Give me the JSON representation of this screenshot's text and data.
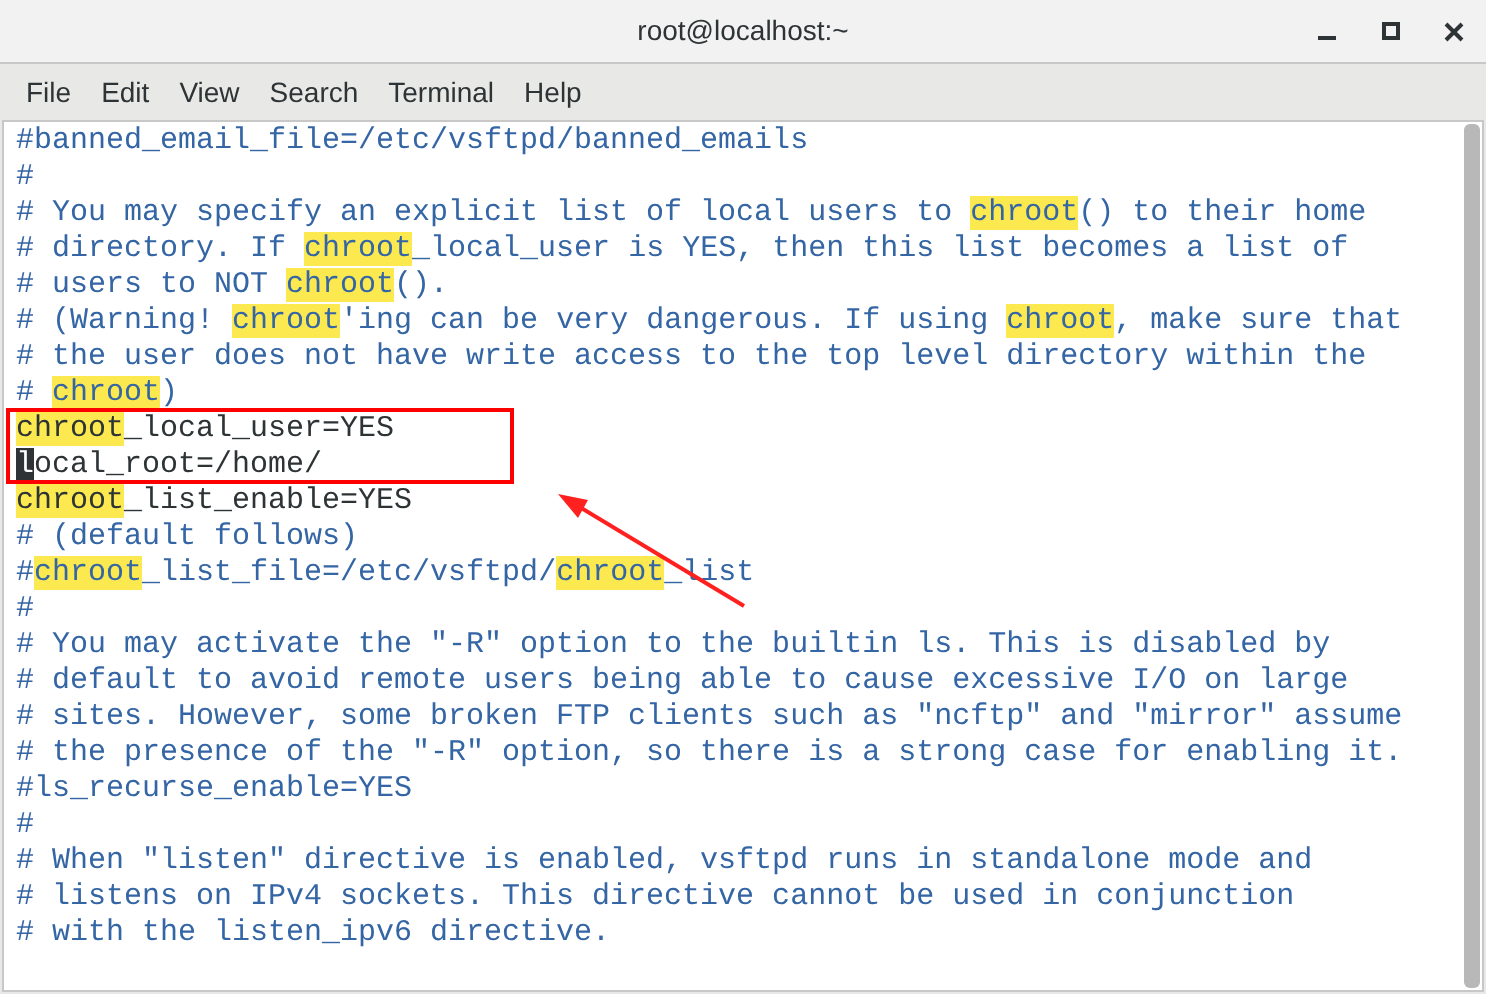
{
  "window": {
    "title": "root@localhost:~"
  },
  "menu": [
    "File",
    "Edit",
    "View",
    "Search",
    "Terminal",
    "Help"
  ],
  "lines": [
    {
      "kind": "comment",
      "segments": [
        {
          "kind": "plain",
          "text": "#banned_email_file=/etc/vsftpd/banned_emails"
        }
      ]
    },
    {
      "kind": "comment",
      "segments": [
        {
          "kind": "plain",
          "text": "#"
        }
      ]
    },
    {
      "kind": "comment",
      "segments": [
        {
          "kind": "plain",
          "text": "# You may specify an explicit list of local users to "
        },
        {
          "kind": "match",
          "text": "chroot"
        },
        {
          "kind": "plain",
          "text": "() to their home"
        }
      ]
    },
    {
      "kind": "comment",
      "segments": [
        {
          "kind": "plain",
          "text": "# directory. If "
        },
        {
          "kind": "match",
          "text": "chroot"
        },
        {
          "kind": "plain",
          "text": "_local_user is YES, then this list becomes a list of"
        }
      ]
    },
    {
      "kind": "comment",
      "segments": [
        {
          "kind": "plain",
          "text": "# users to NOT "
        },
        {
          "kind": "match",
          "text": "chroot"
        },
        {
          "kind": "plain",
          "text": "()."
        }
      ]
    },
    {
      "kind": "comment",
      "segments": [
        {
          "kind": "plain",
          "text": "# (Warning! "
        },
        {
          "kind": "match",
          "text": "chroot"
        },
        {
          "kind": "plain",
          "text": "'ing can be very dangerous. If using "
        },
        {
          "kind": "match",
          "text": "chroot"
        },
        {
          "kind": "plain",
          "text": ", make sure that"
        }
      ]
    },
    {
      "kind": "comment",
      "segments": [
        {
          "kind": "plain",
          "text": "# the user does not have write access to the top level directory within the"
        }
      ]
    },
    {
      "kind": "comment",
      "segments": [
        {
          "kind": "plain",
          "text": "# "
        },
        {
          "kind": "match",
          "text": "chroot"
        },
        {
          "kind": "plain",
          "text": ")"
        }
      ]
    },
    {
      "kind": "code",
      "segments": [
        {
          "kind": "match",
          "text": "chroot"
        },
        {
          "kind": "plain",
          "text": "_local_user=YES"
        }
      ]
    },
    {
      "kind": "code",
      "segments": [
        {
          "kind": "cursor",
          "text": "l"
        },
        {
          "kind": "plain",
          "text": "ocal_root=/home/"
        }
      ]
    },
    {
      "kind": "code",
      "segments": [
        {
          "kind": "match",
          "text": "chroot"
        },
        {
          "kind": "plain",
          "text": "_list_enable=YES"
        }
      ]
    },
    {
      "kind": "comment",
      "segments": [
        {
          "kind": "plain",
          "text": "# (default follows)"
        }
      ]
    },
    {
      "kind": "comment",
      "segments": [
        {
          "kind": "plain",
          "text": "#"
        },
        {
          "kind": "match",
          "text": "chroot"
        },
        {
          "kind": "plain",
          "text": "_list_file=/etc/vsftpd/"
        },
        {
          "kind": "match",
          "text": "chroot"
        },
        {
          "kind": "plain",
          "text": "_list"
        }
      ]
    },
    {
      "kind": "comment",
      "segments": [
        {
          "kind": "plain",
          "text": "#"
        }
      ]
    },
    {
      "kind": "comment",
      "segments": [
        {
          "kind": "plain",
          "text": "# You may activate the \"-R\" option to the builtin ls. This is disabled by"
        }
      ]
    },
    {
      "kind": "comment",
      "segments": [
        {
          "kind": "plain",
          "text": "# default to avoid remote users being able to cause excessive I/O on large"
        }
      ]
    },
    {
      "kind": "comment",
      "segments": [
        {
          "kind": "plain",
          "text": "# sites. However, some broken FTP clients such as \"ncftp\" and \"mirror\" assume"
        }
      ]
    },
    {
      "kind": "comment",
      "segments": [
        {
          "kind": "plain",
          "text": "# the presence of the \"-R\" option, so there is a strong case for enabling it."
        }
      ]
    },
    {
      "kind": "comment",
      "segments": [
        {
          "kind": "plain",
          "text": "#ls_recurse_enable=YES"
        }
      ]
    },
    {
      "kind": "comment",
      "segments": [
        {
          "kind": "plain",
          "text": "#"
        }
      ]
    },
    {
      "kind": "comment",
      "segments": [
        {
          "kind": "plain",
          "text": "# When \"listen\" directive is enabled, vsftpd runs in standalone mode and"
        }
      ]
    },
    {
      "kind": "comment",
      "segments": [
        {
          "kind": "plain",
          "text": "# listens on IPv4 sockets. This directive cannot be used in conjunction"
        }
      ]
    },
    {
      "kind": "comment",
      "segments": [
        {
          "kind": "plain",
          "text": "# with the listen_ipv6 directive."
        }
      ]
    }
  ]
}
